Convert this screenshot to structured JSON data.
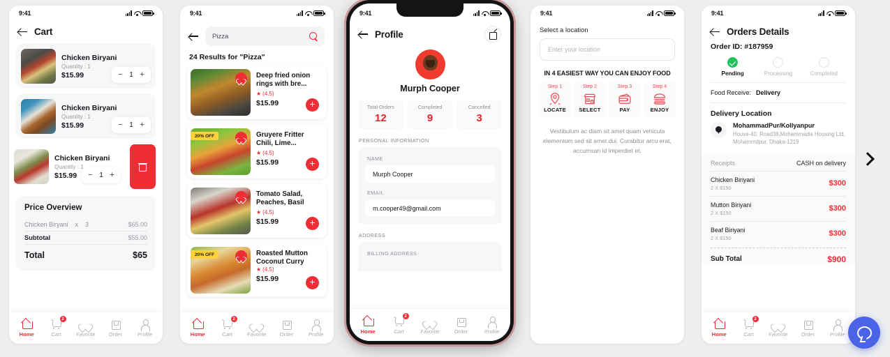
{
  "status_bar": {
    "time": "9:41",
    "signal_icon": "signal-icon",
    "wifi_icon": "wifi-icon",
    "battery_icon": "battery-icon"
  },
  "bottom_nav": {
    "items": [
      {
        "label": "Home",
        "icon": "home-icon",
        "active": true,
        "badge": ""
      },
      {
        "label": "Cart",
        "icon": "cart-icon",
        "active": false,
        "badge": "2"
      },
      {
        "label": "Favorite",
        "icon": "heart-icon",
        "active": false,
        "badge": ""
      },
      {
        "label": "Order",
        "icon": "bag-icon",
        "active": false,
        "badge": ""
      },
      {
        "label": "Profile",
        "icon": "user-icon",
        "active": false,
        "badge": ""
      }
    ]
  },
  "colors": {
    "accent": "#ee2d35",
    "success": "#22c15e",
    "badge_yellow": "#ffd23c",
    "help_blue": "#4a63e7",
    "page_bg": "#eceef0"
  },
  "screen_cart": {
    "title": "Cart",
    "back_icon": "back-arrow-icon",
    "items": [
      {
        "name": "Chicken Biryani",
        "quantity_label": "Quantity : 1",
        "price": "$15.99",
        "stepper_value": "1",
        "minus": "−",
        "plus": "+",
        "swiped": false
      },
      {
        "name": "Chicken Biryani",
        "quantity_label": "Quantity : 1",
        "price": "$15.99",
        "stepper_value": "1",
        "minus": "−",
        "plus": "+",
        "swiped": false
      },
      {
        "name": "Chicken Biryani",
        "quantity_label": "Quantity : 1",
        "price": "$15.99",
        "stepper_value": "1",
        "minus": "−",
        "plus": "+",
        "swiped": true
      }
    ],
    "delete_icon": "trash-icon",
    "price_overview": {
      "title": "Price Overview",
      "line_item_name": "Chicken Biryani",
      "line_item_x": "x",
      "line_item_qty": "3",
      "line_item_price": "$65.00",
      "subtotal_label": "Subtotal",
      "subtotal_value": "$55.00",
      "total_label": "Total",
      "total_value": "$65"
    }
  },
  "screen_search": {
    "back_icon": "back-arrow-icon",
    "search_value": "Pizza",
    "search_placeholder": "Search",
    "search_icon": "search-icon",
    "results_heading": "24 Results for \"Pizza\"",
    "results": [
      {
        "name": "Deep fried onion rings with bre...",
        "rating": "(4.5)",
        "star": "★",
        "price": "$15.99",
        "discount": "",
        "favorite_icon": "heart-icon",
        "add_icon": "plus-icon"
      },
      {
        "name": "Gruyere Fritter Chili, Lime...",
        "rating": "(4.5)",
        "star": "★",
        "price": "$15.99",
        "discount": "20% OFF",
        "favorite_icon": "heart-icon",
        "add_icon": "plus-icon"
      },
      {
        "name": "Tomato Salad, Peaches, Basil",
        "rating": "(4.5)",
        "star": "★",
        "price": "$15.99",
        "discount": "",
        "favorite_icon": "heart-icon",
        "add_icon": "plus-icon"
      },
      {
        "name": "Roasted Mutton Coconut Curry",
        "rating": "(4.5)",
        "star": "★",
        "price": "$15.99",
        "discount": "20% OFF",
        "favorite_icon": "heart-icon",
        "add_icon": "plus-icon"
      }
    ]
  },
  "screen_profile": {
    "title": "Profile",
    "back_icon": "back-arrow-icon",
    "edit_icon": "edit-icon",
    "avatar": "user-avatar",
    "name": "Murph Cooper",
    "stats": [
      {
        "label": "Total Orders",
        "value": "12"
      },
      {
        "label": "Completed",
        "value": "9"
      },
      {
        "label": "Cancelled",
        "value": "3"
      }
    ],
    "personal_info_label": "PERSONAL INFORMATION",
    "name_label": "NAME",
    "name_value": "Murph Cooper",
    "email_label": "EMAIL",
    "email_value": "m.cooper49@gmail.com",
    "address_label": "ADDRESS",
    "billing_address_label": "BILLING ADDRESS"
  },
  "screen_location": {
    "title": "Select a location",
    "input_placeholder": "Enter your location",
    "steps_heading": "IN 4 EASIEST WAY YOU CAN ENJOY FOOD",
    "steps": [
      {
        "step": "Step 1",
        "title": "LOCATE",
        "icon": "map-pin-icon"
      },
      {
        "step": "Step 2",
        "title": "SELECT",
        "icon": "storefront-icon"
      },
      {
        "step": "Step 3",
        "title": "PAY",
        "icon": "wallet-icon"
      },
      {
        "step": "Step 4",
        "title": "ENJOY",
        "icon": "burger-icon"
      }
    ],
    "description": "Vestibulum ac diam sit amet quam vehicula elementum sed sit amet dui. Curabitur arcu erat, accumsan id imperdiet et."
  },
  "screen_order_details": {
    "title": "Orders Details",
    "back_icon": "back-arrow-icon",
    "order_id": "Order ID: #187959",
    "progress": [
      {
        "label": "Pending",
        "state": "done"
      },
      {
        "label": "Processing",
        "state": "pending"
      },
      {
        "label": "Completed",
        "state": "pending"
      }
    ],
    "food_receive_label": "Food Receive:",
    "food_receive_value": "Delivery",
    "delivery_location_title": "Delivery Location",
    "location_pin_icon": "map-pin-icon",
    "location_name": "MohammadPur/Kollyanpur",
    "location_address": "House-40, Road38,Mohammadia Housing Ltd, Mohammdpur, Dhaka-1219",
    "receipts_label": "Receipts",
    "payment_method": "CASH on delivery",
    "receipt_items": [
      {
        "name": "Chicken Biriyani",
        "qty": "2 X  $150",
        "price": "$300"
      },
      {
        "name": "Mutton Biriyani",
        "qty": "2 X  $150",
        "price": "$300"
      },
      {
        "name": "Beaf Biriyani",
        "qty": "2 X  $150",
        "price": "$300"
      }
    ],
    "subtotal_label": "Sub Total",
    "subtotal_value": "$900"
  },
  "overlays": {
    "next_chevron": "chevron-right-icon",
    "help_button": "chat-bubble-icon"
  }
}
